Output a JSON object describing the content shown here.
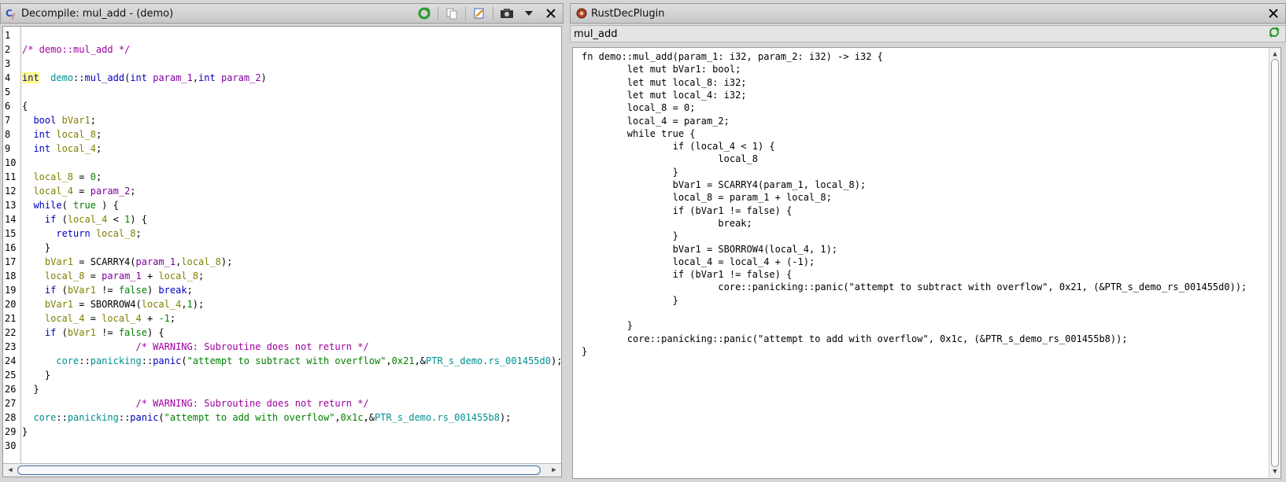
{
  "left_panel": {
    "title": "Decompile: mul_add -  (demo)",
    "line_numbers": [
      "1",
      "2",
      "3",
      "4",
      "5",
      "6",
      "7",
      "8",
      "9",
      "10",
      "11",
      "12",
      "13",
      "14",
      "15",
      "16",
      "17",
      "18",
      "19",
      "20",
      "21",
      "22",
      "23",
      "24",
      "25",
      "26",
      "27",
      "28",
      "29",
      "30"
    ],
    "lines": [
      [],
      [
        [
          "cmt",
          "/* demo::mul_add */"
        ]
      ],
      [],
      [
        [
          "hl ty",
          "int"
        ],
        [
          "",
          "  "
        ],
        [
          "ns",
          "demo"
        ],
        [
          "",
          "::"
        ],
        [
          "fn",
          "mul_add"
        ],
        [
          "",
          "("
        ],
        [
          "ty",
          "int"
        ],
        [
          "",
          " "
        ],
        [
          "prm",
          "param_1"
        ],
        [
          "",
          ","
        ],
        [
          "ty",
          "int"
        ],
        [
          "",
          " "
        ],
        [
          "prm",
          "param_2"
        ],
        [
          "",
          ")"
        ]
      ],
      [],
      [
        [
          "",
          "{"
        ]
      ],
      [
        [
          "",
          "  "
        ],
        [
          "ty",
          "bool"
        ],
        [
          "",
          " "
        ],
        [
          "var",
          "bVar1"
        ],
        [
          "",
          ";"
        ]
      ],
      [
        [
          "",
          "  "
        ],
        [
          "ty",
          "int"
        ],
        [
          "",
          " "
        ],
        [
          "var",
          "local_8"
        ],
        [
          "",
          ";"
        ]
      ],
      [
        [
          "",
          "  "
        ],
        [
          "ty",
          "int"
        ],
        [
          "",
          " "
        ],
        [
          "var",
          "local_4"
        ],
        [
          "",
          ";"
        ]
      ],
      [],
      [
        [
          "",
          "  "
        ],
        [
          "var",
          "local_8"
        ],
        [
          "",
          " = "
        ],
        [
          "num",
          "0"
        ],
        [
          "",
          ";"
        ]
      ],
      [
        [
          "",
          "  "
        ],
        [
          "var",
          "local_4"
        ],
        [
          "",
          " = "
        ],
        [
          "prm",
          "param_2"
        ],
        [
          "",
          ";"
        ]
      ],
      [
        [
          "",
          "  "
        ],
        [
          "kw",
          "while"
        ],
        [
          "",
          "( "
        ],
        [
          "bool",
          "true"
        ],
        [
          "",
          " ) {"
        ]
      ],
      [
        [
          "",
          "    "
        ],
        [
          "kw",
          "if"
        ],
        [
          "",
          " ("
        ],
        [
          "var",
          "local_4"
        ],
        [
          "",
          " < "
        ],
        [
          "num",
          "1"
        ],
        [
          "",
          ") {"
        ]
      ],
      [
        [
          "",
          "      "
        ],
        [
          "kw",
          "return"
        ],
        [
          "",
          " "
        ],
        [
          "var",
          "local_8"
        ],
        [
          "",
          ";"
        ]
      ],
      [
        [
          "",
          "    }"
        ]
      ],
      [
        [
          "",
          "    "
        ],
        [
          "var",
          "bVar1"
        ],
        [
          "",
          " = SCARRY4("
        ],
        [
          "prm",
          "param_1"
        ],
        [
          "",
          ","
        ],
        [
          "var",
          "local_8"
        ],
        [
          "",
          ");"
        ]
      ],
      [
        [
          "",
          "    "
        ],
        [
          "var",
          "local_8"
        ],
        [
          "",
          " = "
        ],
        [
          "prm",
          "param_1"
        ],
        [
          "",
          " + "
        ],
        [
          "var",
          "local_8"
        ],
        [
          "",
          ";"
        ]
      ],
      [
        [
          "",
          "    "
        ],
        [
          "kw",
          "if"
        ],
        [
          "",
          " ("
        ],
        [
          "var",
          "bVar1"
        ],
        [
          "",
          " != "
        ],
        [
          "bool",
          "false"
        ],
        [
          "",
          ") "
        ],
        [
          "kw",
          "break"
        ],
        [
          "",
          ";"
        ]
      ],
      [
        [
          "",
          "    "
        ],
        [
          "var",
          "bVar1"
        ],
        [
          "",
          " = SBORROW4("
        ],
        [
          "var",
          "local_4"
        ],
        [
          "",
          ","
        ],
        [
          "num",
          "1"
        ],
        [
          "",
          ");"
        ]
      ],
      [
        [
          "",
          "    "
        ],
        [
          "var",
          "local_4"
        ],
        [
          "",
          " = "
        ],
        [
          "var",
          "local_4"
        ],
        [
          "",
          " + "
        ],
        [
          "num",
          "-1"
        ],
        [
          "",
          ";"
        ]
      ],
      [
        [
          "",
          "    "
        ],
        [
          "kw",
          "if"
        ],
        [
          "",
          " ("
        ],
        [
          "var",
          "bVar1"
        ],
        [
          "",
          " != "
        ],
        [
          "bool",
          "false"
        ],
        [
          "",
          ") {"
        ]
      ],
      [
        [
          "",
          "                    "
        ],
        [
          "cmt",
          "/* WARNING: Subroutine does not return */"
        ]
      ],
      [
        [
          "",
          "      "
        ],
        [
          "ns",
          "core"
        ],
        [
          "",
          "::"
        ],
        [
          "ns",
          "panicking"
        ],
        [
          "",
          "::"
        ],
        [
          "fn",
          "panic"
        ],
        [
          "",
          "("
        ],
        [
          "str",
          "\"attempt to subtract with overflow\""
        ],
        [
          "",
          ","
        ],
        [
          "num",
          "0x21"
        ],
        [
          "",
          ",&"
        ],
        [
          "glob",
          "PTR_s_demo.rs_001455d0"
        ],
        [
          "",
          ");"
        ]
      ],
      [
        [
          "",
          "    }"
        ]
      ],
      [
        [
          "",
          "  }"
        ]
      ],
      [
        [
          "",
          "                    "
        ],
        [
          "cmt",
          "/* WARNING: Subroutine does not return */"
        ]
      ],
      [
        [
          "",
          "  "
        ],
        [
          "ns",
          "core"
        ],
        [
          "",
          "::"
        ],
        [
          "ns",
          "panicking"
        ],
        [
          "",
          "::"
        ],
        [
          "fn",
          "panic"
        ],
        [
          "",
          "("
        ],
        [
          "str",
          "\"attempt to add with overflow\""
        ],
        [
          "",
          ","
        ],
        [
          "num",
          "0x1c"
        ],
        [
          "",
          ",&"
        ],
        [
          "glob",
          "PTR_s_demo.rs_001455b8"
        ],
        [
          "",
          ");"
        ]
      ],
      [
        [
          "",
          "}"
        ]
      ],
      []
    ]
  },
  "right_panel": {
    "title": "RustDecPlugin",
    "function_name": "mul_add",
    "lines": [
      "fn demo::mul_add(param_1: i32, param_2: i32) -> i32 {",
      "        let mut bVar1: bool;",
      "        let mut local_8: i32;",
      "        let mut local_4: i32;",
      "        local_8 = 0;",
      "        local_4 = param_2;",
      "        while true {",
      "                if (local_4 < 1) {",
      "                        local_8",
      "                }",
      "                bVar1 = SCARRY4(param_1, local_8);",
      "                local_8 = param_1 + local_8;",
      "                if (bVar1 != false) {",
      "                        break;",
      "                }",
      "                bVar1 = SBORROW4(local_4, 1);",
      "                local_4 = local_4 + (-1);",
      "                if (bVar1 != false) {",
      "                        core::panicking::panic(\"attempt to subtract with overflow\", 0x21, (&PTR_s_demo_rs_001455d0));",
      "                }",
      "",
      "        }",
      "        core::panicking::panic(\"attempt to add with overflow\", 0x1c, (&PTR_s_demo_rs_001455b8));",
      "}"
    ]
  },
  "icons": {
    "decompiler": "decompile-icon",
    "refresh": "refresh-icon",
    "copy": "copy-icon",
    "edit": "edit-function-icon",
    "snapshot": "snapshot-icon",
    "menu": "dropdown-menu-icon",
    "close": "close-icon",
    "plugin": "plugin-icon",
    "reload": "reload-icon"
  }
}
